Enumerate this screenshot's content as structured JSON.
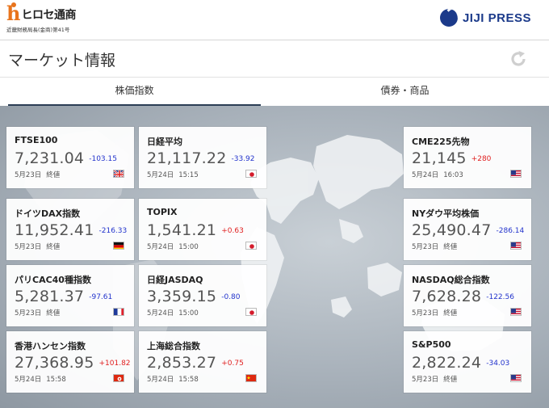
{
  "header": {
    "brand_name": "ヒロセ通商",
    "brand_sub": "近畿財務局長(金商)第41号",
    "partner_name": "JIJI PRESS"
  },
  "page": {
    "title": "マーケット情報"
  },
  "tabs": [
    {
      "label": "株価指数",
      "active": true
    },
    {
      "label": "債券・商品",
      "active": false
    }
  ],
  "colors": {
    "up": "#e02020",
    "down": "#2233cc",
    "tab_underline": "#2c3e55",
    "brand_orange": "#e8741c",
    "jiji_blue": "#1b3a8a"
  },
  "markets": [
    {
      "name": "FTSE100",
      "value": "7,231.04",
      "change": "-103.15",
      "direction": "down",
      "date": "5月23日",
      "time": "終値",
      "flag": "uk-flag-icon"
    },
    {
      "name": "日経平均",
      "value": "21,117.22",
      "change": "-33.92",
      "direction": "down",
      "date": "5月24日",
      "time": "15:15",
      "flag": "japan-flag-icon"
    },
    {
      "name": "CME225先物",
      "value": "21,145",
      "change": "+280",
      "direction": "up",
      "date": "5月24日",
      "time": "16:03",
      "flag": "us-flag-icon"
    },
    {
      "name": "ドイツDAX指数",
      "value": "11,952.41",
      "change": "-216.33",
      "direction": "down",
      "date": "5月23日",
      "time": "終値",
      "flag": "germany-flag-icon"
    },
    {
      "name": "TOPIX",
      "value": "1,541.21",
      "change": "+0.63",
      "direction": "up",
      "date": "5月24日",
      "time": "15:00",
      "flag": "japan-flag-icon"
    },
    {
      "name": "NYダウ平均株価",
      "value": "25,490.47",
      "change": "-286.14",
      "direction": "down",
      "date": "5月23日",
      "time": "終値",
      "flag": "us-flag-icon"
    },
    {
      "name": "パリCAC40種指数",
      "value": "5,281.37",
      "change": "-97.61",
      "direction": "down",
      "date": "5月23日",
      "time": "終値",
      "flag": "france-flag-icon"
    },
    {
      "name": "日経JASDAQ",
      "value": "3,359.15",
      "change": "-0.80",
      "direction": "down",
      "date": "5月24日",
      "time": "15:00",
      "flag": "japan-flag-icon"
    },
    {
      "name": "NASDAQ総合指数",
      "value": "7,628.28",
      "change": "-122.56",
      "direction": "down",
      "date": "5月23日",
      "time": "終値",
      "flag": "us-flag-icon"
    },
    {
      "name": "香港ハンセン指数",
      "value": "27,368.95",
      "change": "+101.82",
      "direction": "up",
      "date": "5月24日",
      "time": "15:58",
      "flag": "hongkong-flag-icon"
    },
    {
      "name": "上海総合指数",
      "value": "2,853.27",
      "change": "+0.75",
      "direction": "up",
      "date": "5月24日",
      "time": "15:58",
      "flag": "china-flag-icon"
    },
    {
      "name": "S&P500",
      "value": "2,822.24",
      "change": "-34.03",
      "direction": "down",
      "date": "5月23日",
      "time": "終値",
      "flag": "us-flag-icon"
    }
  ]
}
